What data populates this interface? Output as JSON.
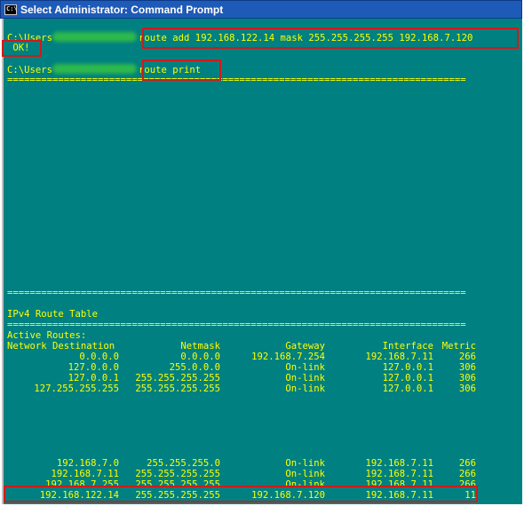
{
  "window": {
    "title": "Select Administrator: Command Prompt",
    "icon_label": "C:\\"
  },
  "console": {
    "prompt_prefix": "C:\\Users",
    "cmd1": "route add 192.168.122.14 mask 255.255.255.255 192.168.7.120",
    "ok": " OK!",
    "cmd2": "route print",
    "separator": "=================================================================================",
    "table_title": "IPv4 Route Table",
    "active_routes": "Active Routes:",
    "headers": [
      "Network Destination",
      "Netmask",
      "Gateway",
      "Interface",
      "Metric"
    ],
    "routes_top": [
      [
        "0.0.0.0",
        "0.0.0.0",
        "192.168.7.254",
        "192.168.7.11",
        "266"
      ],
      [
        "127.0.0.0",
        "255.0.0.0",
        "On-link",
        "127.0.0.1",
        "306"
      ],
      [
        "127.0.0.1",
        "255.255.255.255",
        "On-link",
        "127.0.0.1",
        "306"
      ],
      [
        "127.255.255.255",
        "255.255.255.255",
        "On-link",
        "127.0.0.1",
        "306"
      ]
    ],
    "routes_bottom": [
      [
        "192.168.7.0",
        "255.255.255.0",
        "On-link",
        "192.168.7.11",
        "266"
      ],
      [
        "192.168.7.11",
        "255.255.255.255",
        "On-link",
        "192.168.7.11",
        "266"
      ],
      [
        "192.168.7.255",
        "255.255.255.255",
        "On-link",
        "192.168.7.11",
        "266"
      ],
      [
        "192.168.122.14",
        "255.255.255.255",
        "192.168.7.120",
        "192.168.7.11",
        "11"
      ]
    ]
  }
}
